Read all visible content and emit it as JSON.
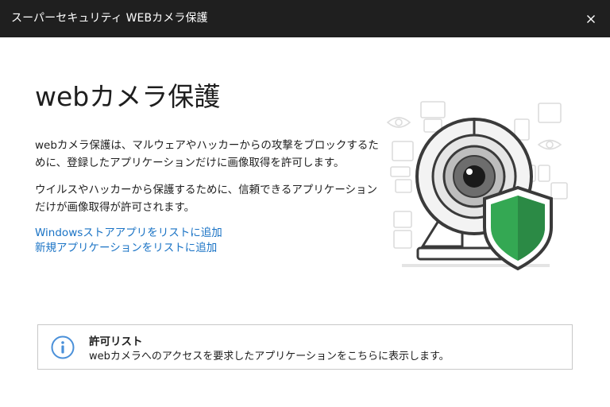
{
  "window": {
    "title": "スーパーセキュリティ WEBカメラ保護",
    "close_icon": "×"
  },
  "main": {
    "heading": "webカメラ保護",
    "paragraph1": "webカメラ保護は、マルウェアやハッカーからの攻撃をブロックするために、登録したアプリケーションだけに画像取得を許可します。",
    "paragraph2": "ウイルスやハッカーから保護するために、信頼できるアプリケーションだけが画像取得が許可されます。",
    "links": [
      "Windowsストアアプリをリストに追加",
      "新規アプリケーションをリストに追加"
    ]
  },
  "info": {
    "title": "許可リスト",
    "text": "webカメラへのアクセスを要求したアプリケーションをこちらに表示します。",
    "icon": "info-icon"
  },
  "colors": {
    "titlebar": "#1f1f1f",
    "link": "#1a73c5",
    "shield": "#34a853",
    "info_icon": "#4a90d9"
  }
}
